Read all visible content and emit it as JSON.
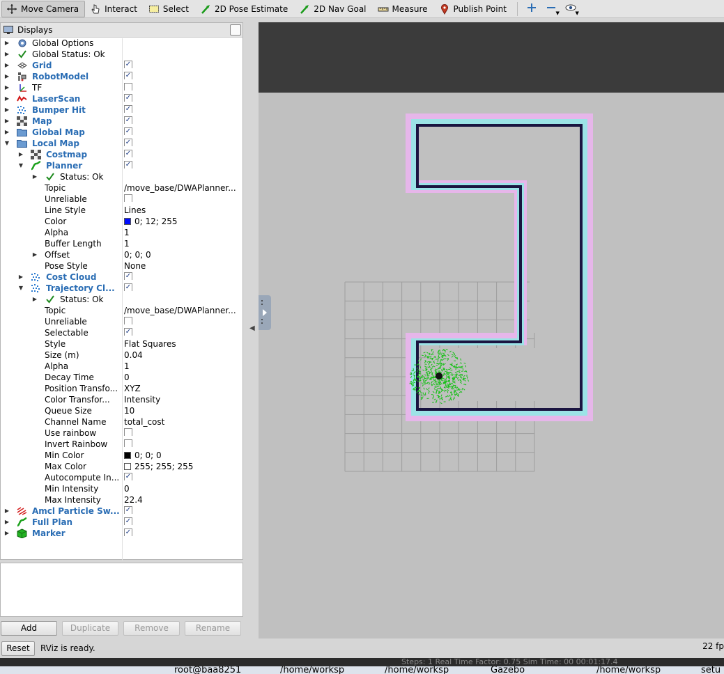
{
  "toolbar": {
    "tools": [
      {
        "name": "move-camera-tool",
        "icon": "move-camera-icon",
        "label": "Move Camera",
        "active": true
      },
      {
        "name": "interact-tool",
        "icon": "hand-pointer-icon",
        "label": "Interact",
        "active": false
      },
      {
        "name": "select-tool",
        "icon": "select-rect-icon",
        "label": "Select",
        "active": false
      },
      {
        "name": "2d-pose-estimate-tool",
        "icon": "green-arrow-icon",
        "label": "2D Pose Estimate",
        "active": false
      },
      {
        "name": "2d-nav-goal-tool",
        "icon": "green-arrow-icon",
        "label": "2D Nav Goal",
        "active": false
      },
      {
        "name": "measure-tool",
        "icon": "ruler-icon",
        "label": "Measure",
        "active": false
      },
      {
        "name": "publish-point-tool",
        "icon": "map-pin-icon",
        "label": "Publish Point",
        "active": false
      }
    ]
  },
  "displays": {
    "title": "Displays",
    "rows": [
      {
        "depth": 0,
        "arrow": "right",
        "icon": "gear-icon",
        "label": "Global Options",
        "bold": false,
        "value": ""
      },
      {
        "depth": 0,
        "arrow": "right",
        "icon": "check-icon",
        "label": "Global Status: Ok",
        "bold": false,
        "value": ""
      },
      {
        "depth": 0,
        "arrow": "right",
        "icon": "grid-icon",
        "label": "Grid",
        "bold": true,
        "check": true
      },
      {
        "depth": 0,
        "arrow": "right",
        "icon": "robot-model-icon",
        "label": "RobotModel",
        "bold": true,
        "check": true
      },
      {
        "depth": 0,
        "arrow": "right",
        "icon": "tf-axes-icon",
        "label": "TF",
        "bold": false,
        "check": false
      },
      {
        "depth": 0,
        "arrow": "right",
        "icon": "laser-scan-icon",
        "label": "LaserScan",
        "bold": true,
        "check": true
      },
      {
        "depth": 0,
        "arrow": "right",
        "icon": "point-cloud-icon",
        "label": "Bumper Hit",
        "bold": true,
        "check": true
      },
      {
        "depth": 0,
        "arrow": "right",
        "icon": "map-icon",
        "label": "Map",
        "bold": true,
        "check": true
      },
      {
        "depth": 0,
        "arrow": "right",
        "icon": "folder-icon",
        "label": "Global Map",
        "bold": true,
        "check": true
      },
      {
        "depth": 0,
        "arrow": "down",
        "icon": "folder-icon",
        "label": "Local Map",
        "bold": true,
        "check": true
      },
      {
        "depth": 1,
        "arrow": "right",
        "icon": "map-icon",
        "label": "Costmap",
        "bold": true,
        "check": true
      },
      {
        "depth": 1,
        "arrow": "down",
        "icon": "path-icon",
        "label": "Planner",
        "bold": true,
        "check": true
      },
      {
        "depth": 2,
        "arrow": "right",
        "icon": "check-icon",
        "label": "Status: Ok",
        "bold": false,
        "value": ""
      },
      {
        "depth": 2,
        "arrow": "",
        "icon": "",
        "label": "Topic",
        "bold": false,
        "value": "/move_base/DWAPlanner..."
      },
      {
        "depth": 2,
        "arrow": "",
        "icon": "",
        "label": "Unreliable",
        "bold": false,
        "check": false
      },
      {
        "depth": 2,
        "arrow": "",
        "icon": "",
        "label": "Line Style",
        "bold": false,
        "value": "Lines"
      },
      {
        "depth": 2,
        "arrow": "",
        "icon": "",
        "label": "Color",
        "bold": false,
        "value": "0; 12; 255",
        "swatch": "#000cff"
      },
      {
        "depth": 2,
        "arrow": "",
        "icon": "",
        "label": "Alpha",
        "bold": false,
        "value": "1"
      },
      {
        "depth": 2,
        "arrow": "",
        "icon": "",
        "label": "Buffer Length",
        "bold": false,
        "value": "1"
      },
      {
        "depth": 2,
        "arrow": "right",
        "icon": "",
        "label": "Offset",
        "bold": false,
        "value": "0; 0; 0"
      },
      {
        "depth": 2,
        "arrow": "",
        "icon": "",
        "label": "Pose Style",
        "bold": false,
        "value": "None"
      },
      {
        "depth": 1,
        "arrow": "right",
        "icon": "point-cloud-icon",
        "label": "Cost Cloud",
        "bold": true,
        "check": true
      },
      {
        "depth": 1,
        "arrow": "down",
        "icon": "point-cloud-icon",
        "label": "Trajectory Cl...",
        "bold": true,
        "check": true
      },
      {
        "depth": 2,
        "arrow": "right",
        "icon": "check-icon",
        "label": "Status: Ok",
        "bold": false,
        "value": ""
      },
      {
        "depth": 2,
        "arrow": "",
        "icon": "",
        "label": "Topic",
        "bold": false,
        "value": "/move_base/DWAPlanner..."
      },
      {
        "depth": 2,
        "arrow": "",
        "icon": "",
        "label": "Unreliable",
        "bold": false,
        "check": false
      },
      {
        "depth": 2,
        "arrow": "",
        "icon": "",
        "label": "Selectable",
        "bold": false,
        "check": true
      },
      {
        "depth": 2,
        "arrow": "",
        "icon": "",
        "label": "Style",
        "bold": false,
        "value": "Flat Squares"
      },
      {
        "depth": 2,
        "arrow": "",
        "icon": "",
        "label": "Size (m)",
        "bold": false,
        "value": "0.04"
      },
      {
        "depth": 2,
        "arrow": "",
        "icon": "",
        "label": "Alpha",
        "bold": false,
        "value": "1"
      },
      {
        "depth": 2,
        "arrow": "",
        "icon": "",
        "label": "Decay Time",
        "bold": false,
        "value": "0"
      },
      {
        "depth": 2,
        "arrow": "",
        "icon": "",
        "label": "Position Transfo...",
        "bold": false,
        "value": "XYZ"
      },
      {
        "depth": 2,
        "arrow": "",
        "icon": "",
        "label": "Color Transfor...",
        "bold": false,
        "value": "Intensity"
      },
      {
        "depth": 2,
        "arrow": "",
        "icon": "",
        "label": "Queue Size",
        "bold": false,
        "value": "10"
      },
      {
        "depth": 2,
        "arrow": "",
        "icon": "",
        "label": "Channel Name",
        "bold": false,
        "value": "total_cost"
      },
      {
        "depth": 2,
        "arrow": "",
        "icon": "",
        "label": "Use rainbow",
        "bold": false,
        "check": false
      },
      {
        "depth": 2,
        "arrow": "",
        "icon": "",
        "label": "Invert Rainbow",
        "bold": false,
        "check": false
      },
      {
        "depth": 2,
        "arrow": "",
        "icon": "",
        "label": "Min Color",
        "bold": false,
        "value": "0; 0; 0",
        "swatch": "#000000"
      },
      {
        "depth": 2,
        "arrow": "",
        "icon": "",
        "label": "Max Color",
        "bold": false,
        "value": "255; 255; 255",
        "swatch": "#ffffff"
      },
      {
        "depth": 2,
        "arrow": "",
        "icon": "",
        "label": "Autocompute In...",
        "bold": false,
        "check": true
      },
      {
        "depth": 2,
        "arrow": "",
        "icon": "",
        "label": "Min Intensity",
        "bold": false,
        "value": "0"
      },
      {
        "depth": 2,
        "arrow": "",
        "icon": "",
        "label": "Max Intensity",
        "bold": false,
        "value": "22.4"
      },
      {
        "depth": 0,
        "arrow": "right",
        "icon": "particle-swarm-icon",
        "label": "Amcl Particle Sw...",
        "bold": true,
        "check": true
      },
      {
        "depth": 0,
        "arrow": "right",
        "icon": "path-icon",
        "label": "Full Plan",
        "bold": true,
        "check": true
      },
      {
        "depth": 0,
        "arrow": "right",
        "icon": "marker-cube-icon",
        "label": "Marker",
        "bold": true,
        "check": true
      }
    ]
  },
  "buttons": {
    "add": "Add",
    "duplicate": "Duplicate",
    "remove": "Remove",
    "rename": "Rename"
  },
  "status": {
    "reset": "Reset",
    "message": "RViz is ready.",
    "fps": "22 fp"
  },
  "colors": {
    "link_blue": "#2a6db4",
    "wall": "#1a1440",
    "inflation_cyan": "#9ce3e6",
    "inflation_pink": "#e6b6ea",
    "particles": "#18c018"
  },
  "taskbar": {
    "gazebo_bar": "Steps: 1     Real Time Factor: 0.75          Sim Time: 00 00:01:17.4",
    "items": [
      "root@baa8251",
      "/home/worksp",
      "/home/worksp",
      "Gazebo",
      "/home/worksp",
      "setu"
    ]
  }
}
